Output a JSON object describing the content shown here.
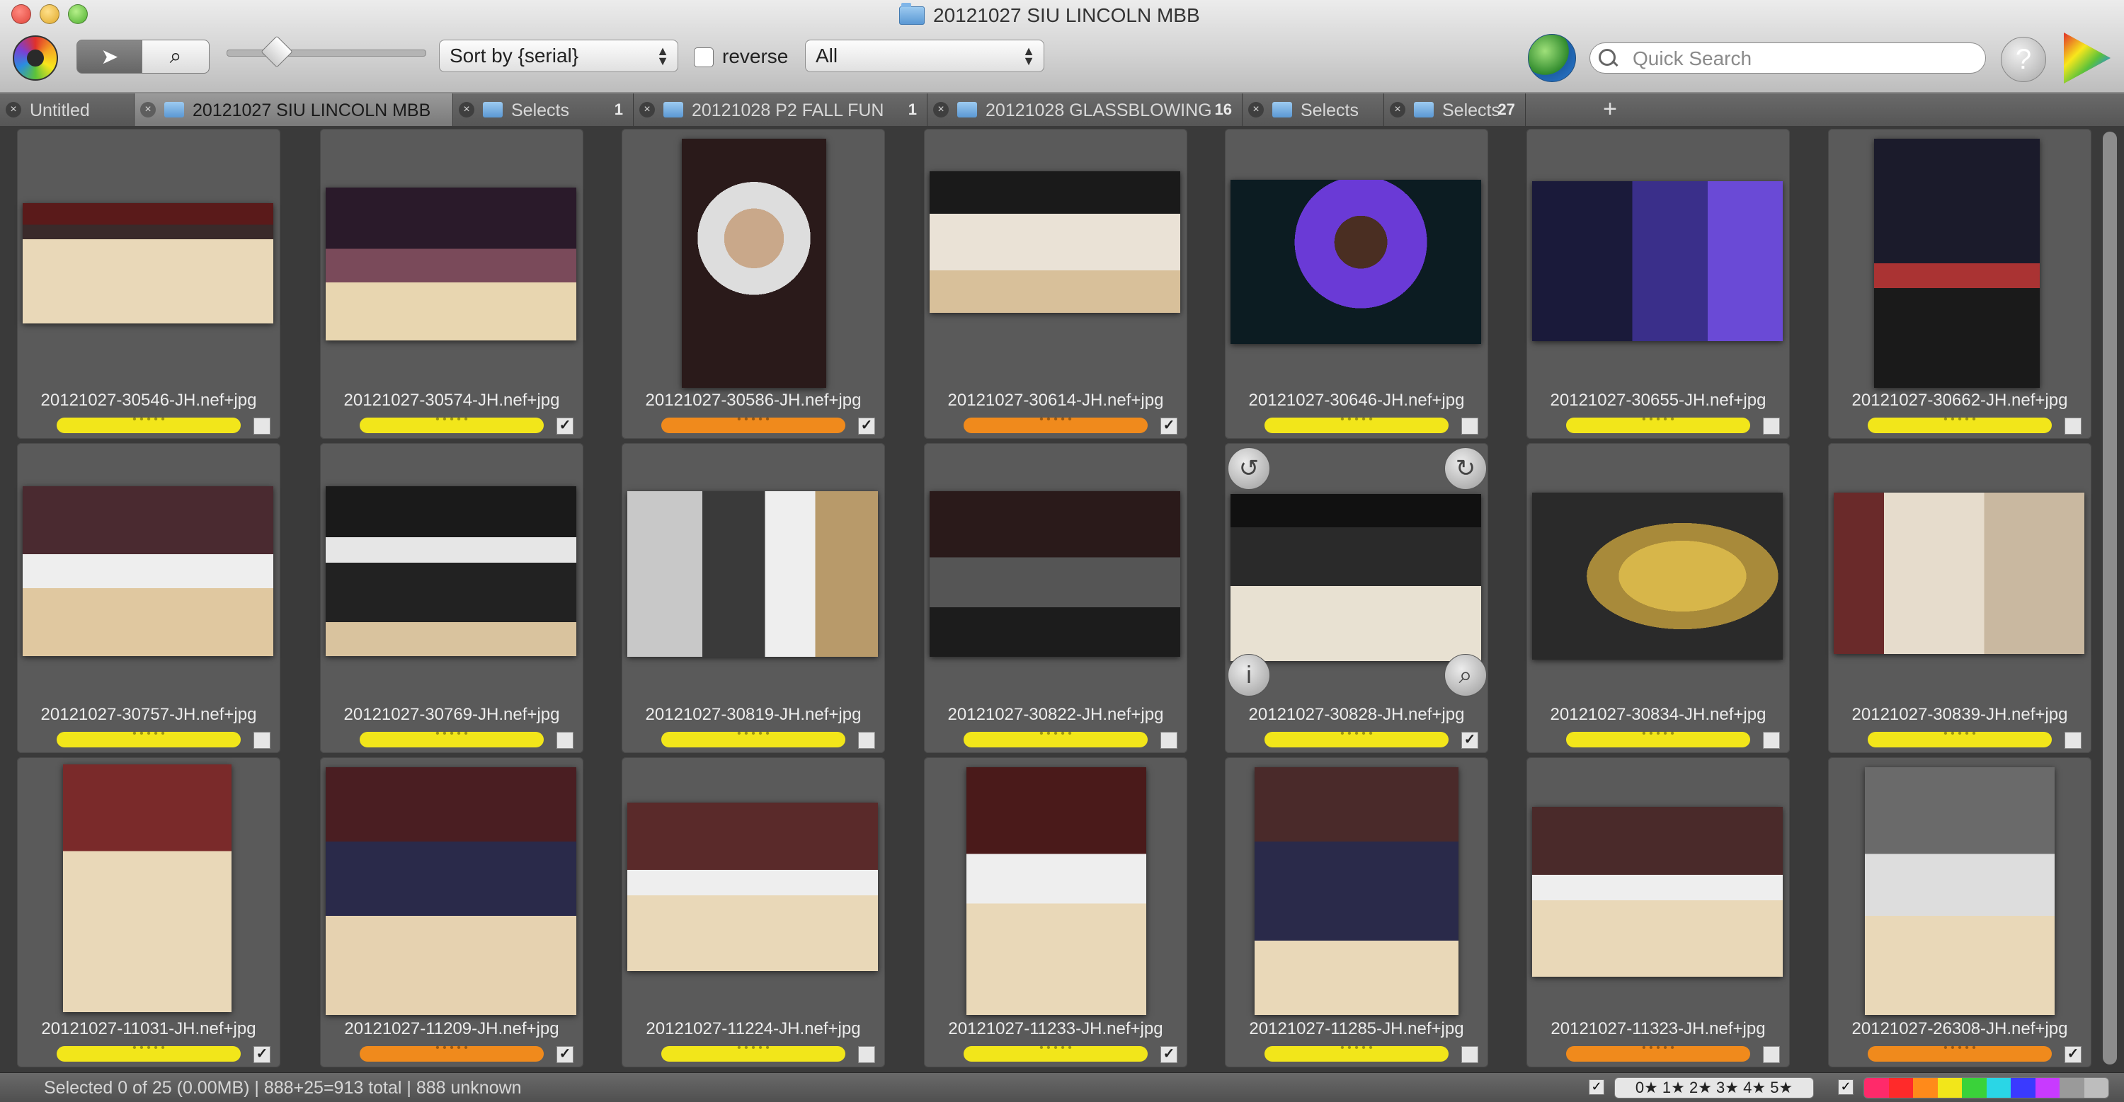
{
  "window": {
    "title": "20121027 SIU LINCOLN MBB"
  },
  "toolbar": {
    "sort_label": "Sort by {serial}",
    "reverse_label": "reverse",
    "filter_label": "All",
    "search_placeholder": "Quick Search"
  },
  "tabs": [
    {
      "label": "Untitled",
      "count": "",
      "folder": false,
      "active": false
    },
    {
      "label": "20121027 SIU LINCOLN MBB",
      "count": "",
      "folder": true,
      "active": true
    },
    {
      "label": "Selects",
      "count": "1",
      "folder": true,
      "active": false
    },
    {
      "label": "20121028 P2 FALL FUN",
      "count": "1",
      "folder": true,
      "active": false
    },
    {
      "label": "20121028 GLASSBLOWING",
      "count": "16",
      "folder": true,
      "active": false
    },
    {
      "label": "Selects",
      "count": "",
      "folder": true,
      "active": false
    },
    {
      "label": "Selects",
      "count": "27",
      "folder": true,
      "active": false
    }
  ],
  "tab_add_label": "+",
  "thumbnails": [
    {
      "filename": "20121027-30546-JH.nef+jpg",
      "label_color": "#f2e61a",
      "checked": false
    },
    {
      "filename": "20121027-30574-JH.nef+jpg",
      "label_color": "#f2e61a",
      "checked": true
    },
    {
      "filename": "20121027-30586-JH.nef+jpg",
      "label_color": "#f08a1c",
      "checked": true
    },
    {
      "filename": "20121027-30614-JH.nef+jpg",
      "label_color": "#f08a1c",
      "checked": true
    },
    {
      "filename": "20121027-30646-JH.nef+jpg",
      "label_color": "#f2e61a",
      "checked": false
    },
    {
      "filename": "20121027-30655-JH.nef+jpg",
      "label_color": "#f2e61a",
      "checked": false
    },
    {
      "filename": "20121027-30662-JH.nef+jpg",
      "label_color": "#f2e61a",
      "checked": false
    },
    {
      "filename": "20121027-30757-JH.nef+jpg",
      "label_color": "#f2e61a",
      "checked": false
    },
    {
      "filename": "20121027-30769-JH.nef+jpg",
      "label_color": "#f2e61a",
      "checked": false
    },
    {
      "filename": "20121027-30819-JH.nef+jpg",
      "label_color": "#f2e61a",
      "checked": false
    },
    {
      "filename": "20121027-30822-JH.nef+jpg",
      "label_color": "#f2e61a",
      "checked": false
    },
    {
      "filename": "20121027-30828-JH.nef+jpg",
      "label_color": "#f2e61a",
      "checked": true
    },
    {
      "filename": "20121027-30834-JH.nef+jpg",
      "label_color": "#f2e61a",
      "checked": false
    },
    {
      "filename": "20121027-30839-JH.nef+jpg",
      "label_color": "#f2e61a",
      "checked": false
    },
    {
      "filename": "20121027-11031-JH.nef+jpg",
      "label_color": "#f2e61a",
      "checked": true
    },
    {
      "filename": "20121027-11209-JH.nef+jpg",
      "label_color": "#f08a1c",
      "checked": true
    },
    {
      "filename": "20121027-11224-JH.nef+jpg",
      "label_color": "#f2e61a",
      "checked": false
    },
    {
      "filename": "20121027-11233-JH.nef+jpg",
      "label_color": "#f2e61a",
      "checked": true
    },
    {
      "filename": "20121027-11285-JH.nef+jpg",
      "label_color": "#f2e61a",
      "checked": false
    },
    {
      "filename": "20121027-11323-JH.nef+jpg",
      "label_color": "#f08a1c",
      "checked": false
    },
    {
      "filename": "20121027-26308-JH.nef+jpg",
      "label_color": "#f08a1c",
      "checked": true
    }
  ],
  "status": {
    "text": "Selected 0 of 25 (0.00MB) | 888+25=913 total | 888 unknown",
    "rating_filter": "0★ 1★ 2★ 3★ 4★ 5★"
  },
  "colors": {
    "label_yellow": "#f2e61a",
    "label_orange": "#f08a1c",
    "color_filter": [
      "#ff2a6a",
      "#ff2a2a",
      "#ff8a1a",
      "#f2e61a",
      "#3ad23a",
      "#2ad6e6",
      "#3a3aff",
      "#c83aff",
      "#9a9a9a",
      "#bdbdbd"
    ]
  },
  "icons": {
    "app_logo": "app-logo-icon",
    "arrow_tool": "pointer-icon",
    "zoom_tool": "magnifier-icon",
    "globe": "globe-icon",
    "help": "help-icon",
    "color_wheel": "color-wheel-icon",
    "rotate_left": "rotate-left-icon",
    "rotate_right": "rotate-right-icon",
    "info": "info-icon",
    "zoom_preview": "zoom-icon"
  }
}
